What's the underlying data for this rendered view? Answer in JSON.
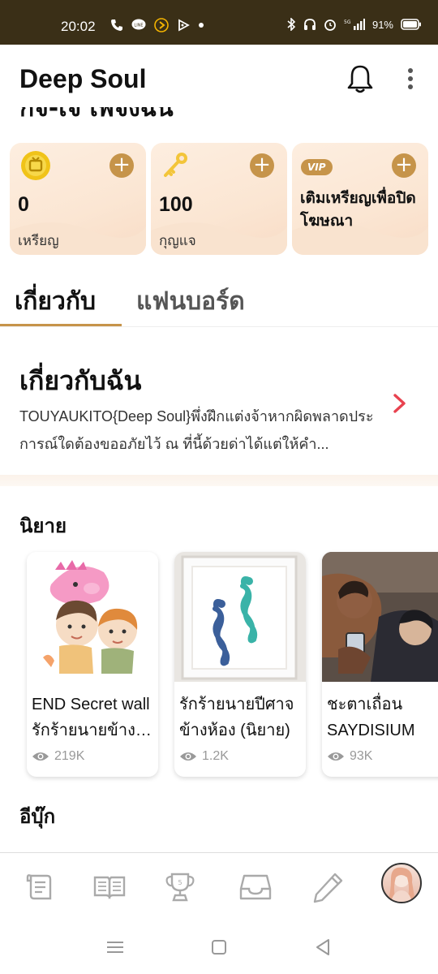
{
  "status_bar": {
    "time": "20:02",
    "network": "5G",
    "battery": "91%"
  },
  "header": {
    "title": "Deep Soul"
  },
  "scrolled_title": "กิจ-เจ เพจงฉัน",
  "wallet": {
    "coins": {
      "value": "0",
      "label": "เหรียญ"
    },
    "keys": {
      "value": "100",
      "label": "กุญแจ"
    },
    "vip": {
      "badge": "VIP",
      "text": "เติมเหรียญเพื่อปิดโฆษณา"
    }
  },
  "tabs": [
    {
      "label": "เกี่ยวกับ",
      "active": true
    },
    {
      "label": "แฟนบอร์ด",
      "active": false
    }
  ],
  "about": {
    "heading": "เกี่ยวกับฉัน",
    "description": "TOUYAUKITO{Deep Soul}พึ่งฝึกแต่งจ้าหากผิดพลาดประการณ์ใดต้องขออภัยไว้ ณ ที่นี้ด้วยด่าได้แต่ให้คำ..."
  },
  "sections": {
    "novels_title": "นิยาย",
    "ebooks_title": "อีบุ๊ก"
  },
  "novels": [
    {
      "title": "END Secret wall รักร้ายนายข้างบ้าน",
      "views": "219K"
    },
    {
      "title": "รักร้ายนายปีศาจข้างห้อง (นิยาย)",
      "views": "1.2K"
    },
    {
      "title": "ชะตาเถื่อน SAYDISIUM",
      "views": "93K"
    }
  ],
  "colors": {
    "status_bar": "#3a2f17",
    "accent_gold": "#c6944a",
    "arrow_red": "#e8424f",
    "card_bg": "#fbe6d3"
  },
  "bottom_nav": [
    "scroll-icon",
    "book-icon",
    "trophy-icon",
    "inbox-icon",
    "pencil-icon",
    "avatar"
  ]
}
